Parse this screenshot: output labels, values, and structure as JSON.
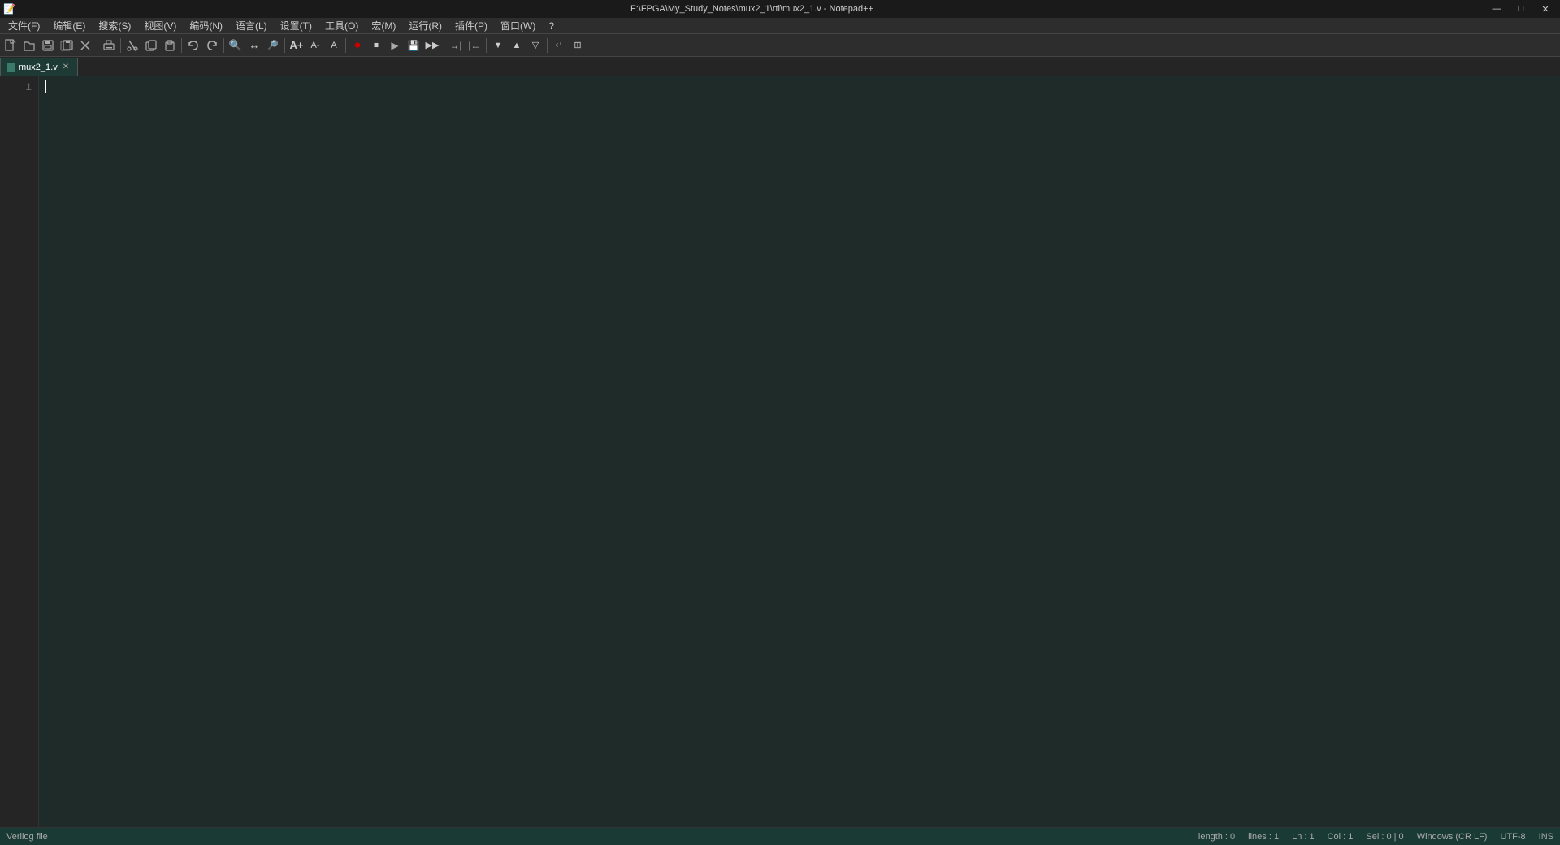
{
  "titlebar": {
    "title": "F:\\FPGA\\My_Study_Notes\\mux2_1\\rtl\\mux2_1.v - Notepad++",
    "minimize_label": "—",
    "maximize_label": "□",
    "close_label": "✕"
  },
  "menubar": {
    "items": [
      {
        "id": "file",
        "label": "文件(F)"
      },
      {
        "id": "edit",
        "label": "编辑(E)"
      },
      {
        "id": "search",
        "label": "搜索(S)"
      },
      {
        "id": "view",
        "label": "视图(V)"
      },
      {
        "id": "encoding",
        "label": "编码(N)"
      },
      {
        "id": "language",
        "label": "语言(L)"
      },
      {
        "id": "settings",
        "label": "设置(T)"
      },
      {
        "id": "tools",
        "label": "工具(O)"
      },
      {
        "id": "macro",
        "label": "宏(M)"
      },
      {
        "id": "run",
        "label": "运行(R)"
      },
      {
        "id": "plugins",
        "label": "插件(P)"
      },
      {
        "id": "window",
        "label": "窗口(W)"
      },
      {
        "id": "help",
        "label": "?"
      }
    ]
  },
  "toolbar": {
    "buttons": [
      {
        "id": "new",
        "icon": "📄",
        "tooltip": "New"
      },
      {
        "id": "open",
        "icon": "📂",
        "tooltip": "Open"
      },
      {
        "id": "save",
        "icon": "💾",
        "tooltip": "Save"
      },
      {
        "id": "save-all",
        "icon": "🗂",
        "tooltip": "Save All"
      },
      {
        "id": "close",
        "icon": "✕",
        "tooltip": "Close"
      },
      {
        "id": "sep1",
        "type": "sep"
      },
      {
        "id": "print",
        "icon": "🖨",
        "tooltip": "Print"
      },
      {
        "id": "sep2",
        "type": "sep"
      },
      {
        "id": "cut",
        "icon": "✂",
        "tooltip": "Cut"
      },
      {
        "id": "copy",
        "icon": "📋",
        "tooltip": "Copy"
      },
      {
        "id": "paste",
        "icon": "📌",
        "tooltip": "Paste"
      },
      {
        "id": "sep3",
        "type": "sep"
      },
      {
        "id": "undo",
        "icon": "↩",
        "tooltip": "Undo"
      },
      {
        "id": "redo",
        "icon": "↪",
        "tooltip": "Redo"
      },
      {
        "id": "sep4",
        "type": "sep"
      },
      {
        "id": "find",
        "icon": "🔍",
        "tooltip": "Find"
      },
      {
        "id": "replace",
        "icon": "🔄",
        "tooltip": "Replace"
      },
      {
        "id": "sep5",
        "type": "sep"
      },
      {
        "id": "zoom-in",
        "icon": "+",
        "tooltip": "Zoom In"
      },
      {
        "id": "zoom-out",
        "icon": "−",
        "tooltip": "Zoom Out"
      },
      {
        "id": "sep6",
        "type": "sep"
      },
      {
        "id": "run",
        "icon": "▶",
        "tooltip": "Run"
      },
      {
        "id": "stop",
        "icon": "⏹",
        "tooltip": "Stop"
      }
    ]
  },
  "tabs": [
    {
      "id": "mux2_1",
      "label": "mux2_1.v",
      "active": true,
      "modified": false
    }
  ],
  "editor": {
    "content": "",
    "line_count": 1,
    "cursor_visible": true
  },
  "statusbar": {
    "file_type": "Verilog file",
    "length": "length : 0",
    "lines": "lines : 1",
    "ln": "Ln : 1",
    "col": "Col : 1",
    "sel": "Sel : 0 | 0",
    "line_ending": "Windows (CR LF)",
    "encoding": "UTF-8",
    "ins_mode": "INS"
  }
}
